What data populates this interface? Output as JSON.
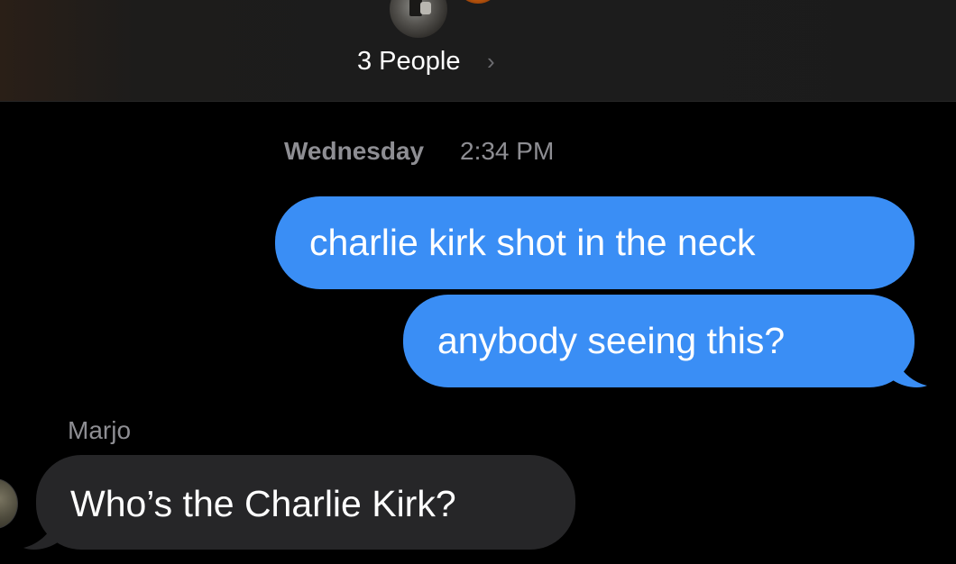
{
  "header": {
    "group_label": "3 People",
    "chevron": "›",
    "avatar_icon": "group-avatar-photo"
  },
  "conversation": {
    "timestamp_day": "Wednesday",
    "timestamp_time": "2:34 PM",
    "messages": [
      {
        "direction": "outgoing",
        "text": "charlie kirk shot in the neck"
      },
      {
        "direction": "outgoing",
        "text": "anybody seeing this?"
      },
      {
        "direction": "incoming",
        "sender": "Marjo",
        "text": "Who’s the Charlie Kirk?"
      }
    ]
  },
  "colors": {
    "outgoing_bubble": "#3a8ef5",
    "incoming_bubble": "#262628",
    "secondary_text": "#8e8e93",
    "background": "#000000"
  }
}
